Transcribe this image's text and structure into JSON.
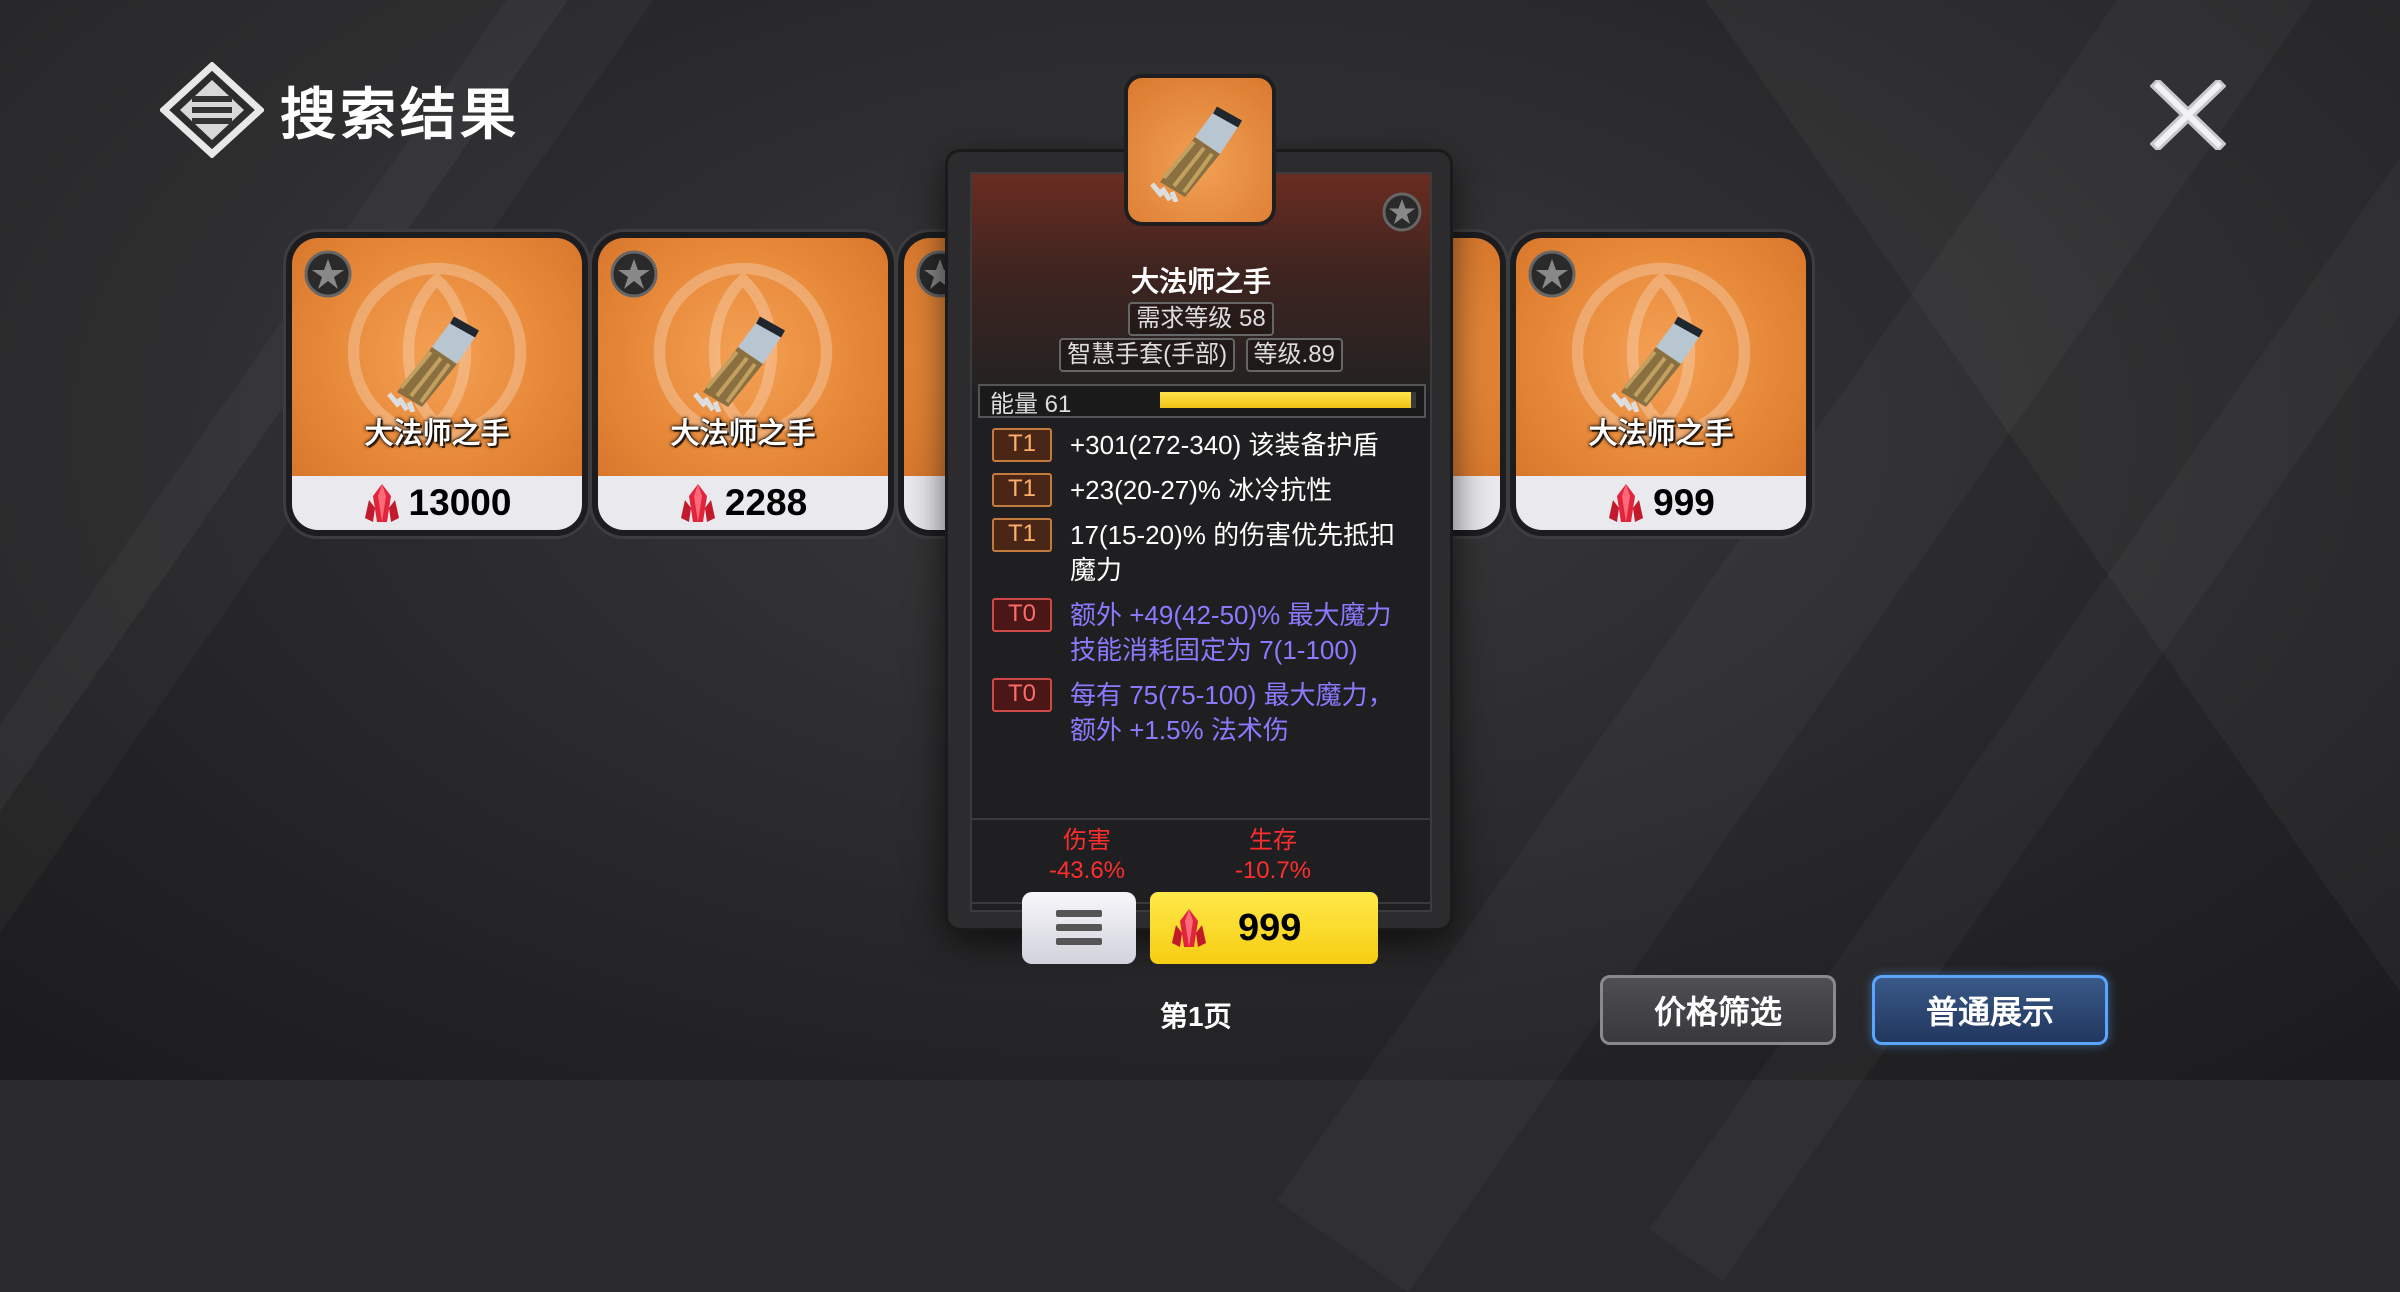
{
  "header": {
    "title": "搜索结果",
    "logo_icon": "three-bars-diamond-logo",
    "close_icon": "close-icon"
  },
  "cards": [
    {
      "name": "大法师之手",
      "price": "13000"
    },
    {
      "name": "大法师之手",
      "price": "2288"
    },
    {
      "name": "",
      "price": ""
    },
    {
      "name": "",
      "price": ""
    },
    {
      "name": "大法师之手",
      "price": "999"
    }
  ],
  "popup": {
    "name": "大法师之手",
    "requirement": "需求等级 58",
    "type": "智慧手套(手部)",
    "level": "等级.89",
    "energy": {
      "label": "能量 61",
      "fill": 0.98
    },
    "affixes": [
      {
        "tier": "T1",
        "text": "+301(272-340) 该装备护盾",
        "style": "normal"
      },
      {
        "tier": "T1",
        "text": "+23(20-27)% 冰冷抗性",
        "style": "normal"
      },
      {
        "tier": "T1",
        "text": "17(15-20)% 的伤害优先抵扣魔力",
        "style": "normal"
      },
      {
        "tier": "T0",
        "text": "额外 +49(42-50)% 最大魔力",
        "sub": "技能消耗固定为 7(1-100)",
        "style": "magic"
      },
      {
        "tier": "T0",
        "text": "每有 75(75-100) 最大魔力，额外 +1.5% 法术伤",
        "style": "magic"
      }
    ],
    "stats": [
      {
        "label": "伤害",
        "value": "-43.6%"
      },
      {
        "label": "生存",
        "value": "-10.7%"
      }
    ],
    "buy_price": "999"
  },
  "page": {
    "label": "第1页"
  },
  "buttons": {
    "price_filter": "价格筛选",
    "normal_display": "普通展示"
  },
  "colors": {
    "card_orange": "#e88a3a",
    "buy_yellow": "#f6cd11",
    "accent_blue": "#5aa6ff",
    "stat_red": "#ff2e2e",
    "magic_purple": "#8a7aff"
  }
}
